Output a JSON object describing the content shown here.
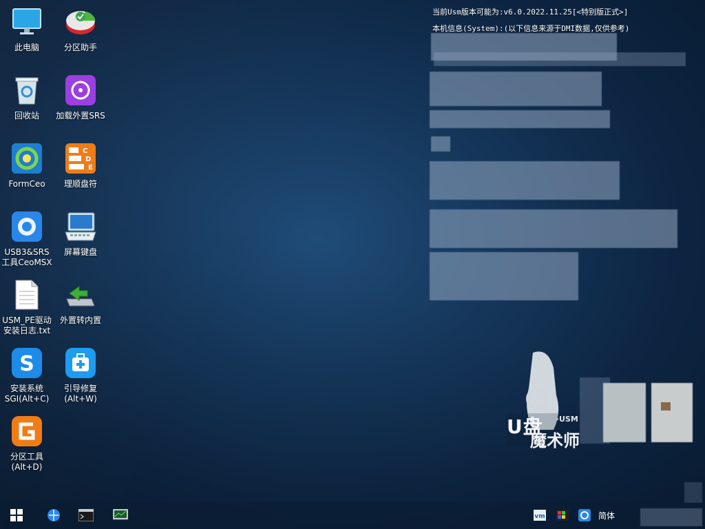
{
  "icons": [
    {
      "label": "此电脑",
      "name": "this-pc-icon"
    },
    {
      "label": "分区助手",
      "name": "partition-assistant-icon"
    },
    {
      "label": "回收站",
      "name": "recycle-bin-icon"
    },
    {
      "label": "加载外置SRS",
      "name": "load-external-srs-icon"
    },
    {
      "label": "FormCeo",
      "name": "formceo-icon"
    },
    {
      "label": "理顺盘符",
      "name": "drive-letter-icon"
    },
    {
      "label": "USB3&SRS\n工具CeoMSX",
      "name": "usb3-srs-tool-icon"
    },
    {
      "label": "屏幕键盘",
      "name": "onscreen-keyboard-icon"
    },
    {
      "label": "USM_PE驱动\n安装日志.txt",
      "name": "driver-log-file-icon"
    },
    {
      "label": "外置转内置",
      "name": "external-to-internal-icon"
    },
    {
      "label": "安装系统\nSGI(Alt+C)",
      "name": "install-system-icon"
    },
    {
      "label": "引导修复\n(Alt+W)",
      "name": "boot-repair-icon"
    },
    {
      "label": "分区工具\n(Alt+D)",
      "name": "diskgenius-icon"
    }
  ],
  "info": {
    "line1": "当前Usm版本可能为:v6.0.2022.11.25[<特别版正式>]",
    "line2": "本机信息(System):(以下信息来源于DMI数据,仅供参考)"
  },
  "logo": {
    "line1": "U盘",
    "line2": "魔术师",
    "badge": "USM"
  },
  "tray": {
    "ime": "简体"
  }
}
